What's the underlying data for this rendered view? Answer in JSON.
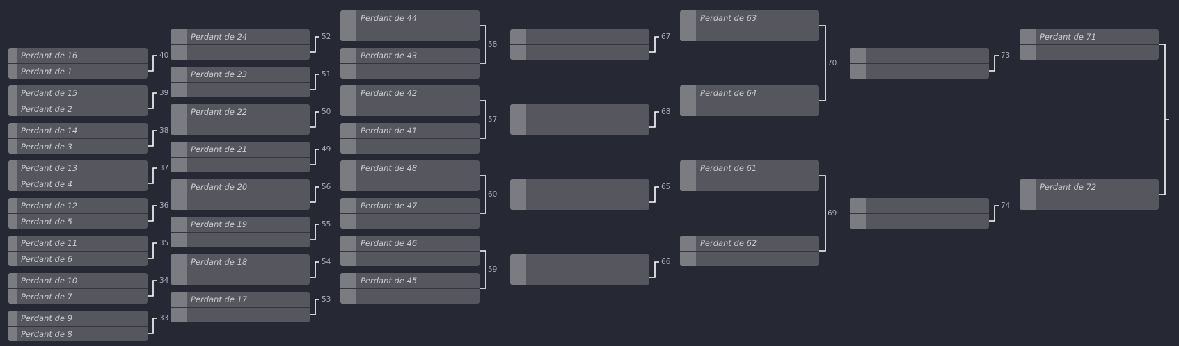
{
  "rounds": [
    {
      "id": "r1",
      "matches": [
        {
          "top": "Perdant de 16",
          "bottom": "Perdant de 1",
          "target": "40"
        },
        {
          "top": "Perdant de 15",
          "bottom": "Perdant de 2",
          "target": "39"
        },
        {
          "top": "Perdant de 14",
          "bottom": "Perdant de 3",
          "target": "38"
        },
        {
          "top": "Perdant de 13",
          "bottom": "Perdant de 4",
          "target": "37"
        },
        {
          "top": "Perdant de 12",
          "bottom": "Perdant de 5",
          "target": "36"
        },
        {
          "top": "Perdant de 11",
          "bottom": "Perdant de 6",
          "target": "35"
        },
        {
          "top": "Perdant de 10",
          "bottom": "Perdant de 7",
          "target": "34"
        },
        {
          "top": "Perdant de 9",
          "bottom": "Perdant de 8",
          "target": "33"
        }
      ]
    },
    {
      "id": "r2",
      "matches": [
        {
          "top": "Perdant de 24",
          "bottom": "",
          "target": "52"
        },
        {
          "top": "Perdant de 23",
          "bottom": "",
          "target": "51"
        },
        {
          "top": "Perdant de 22",
          "bottom": "",
          "target": "50"
        },
        {
          "top": "Perdant de 21",
          "bottom": "",
          "target": "49"
        },
        {
          "top": "Perdant de 20",
          "bottom": "",
          "target": "56"
        },
        {
          "top": "Perdant de 19",
          "bottom": "",
          "target": "55"
        },
        {
          "top": "Perdant de 18",
          "bottom": "",
          "target": "54"
        },
        {
          "top": "Perdant de 17",
          "bottom": "",
          "target": "53"
        }
      ]
    },
    {
      "id": "r3",
      "matches": [
        {
          "top": "Perdant de 44",
          "bottom": ""
        },
        {
          "top": "Perdant de 43",
          "bottom": ""
        },
        {
          "top": "Perdant de 42",
          "bottom": ""
        },
        {
          "top": "Perdant de 41",
          "bottom": ""
        },
        {
          "top": "Perdant de 48",
          "bottom": ""
        },
        {
          "top": "Perdant de 47",
          "bottom": ""
        },
        {
          "top": "Perdant de 46",
          "bottom": ""
        },
        {
          "top": "Perdant de 45",
          "bottom": ""
        }
      ],
      "pair_targets": [
        "58",
        "57",
        "60",
        "59"
      ]
    },
    {
      "id": "r4",
      "matches": [
        {
          "top": "",
          "bottom": "",
          "target": "67"
        },
        {
          "top": "",
          "bottom": "",
          "target": "68"
        },
        {
          "top": "",
          "bottom": "",
          "target": "65"
        },
        {
          "top": "",
          "bottom": "",
          "target": "66"
        }
      ]
    },
    {
      "id": "r5",
      "matches": [
        {
          "top": "Perdant de 63",
          "bottom": ""
        },
        {
          "top": "Perdant de 64",
          "bottom": ""
        },
        {
          "top": "Perdant de 61",
          "bottom": ""
        },
        {
          "top": "Perdant de 62",
          "bottom": ""
        }
      ],
      "pair_targets": [
        "70",
        "69"
      ]
    },
    {
      "id": "r6",
      "matches": [
        {
          "top": "",
          "bottom": "",
          "target": "73"
        },
        {
          "top": "",
          "bottom": "",
          "target": "74"
        }
      ]
    },
    {
      "id": "r7",
      "matches": [
        {
          "top": "Perdant de 71",
          "bottom": ""
        },
        {
          "top": "Perdant de 72",
          "bottom": ""
        }
      ]
    }
  ],
  "colors": {
    "background": "#262833",
    "card": "#56575e",
    "seed": "#7b7c82",
    "line": "#ffffff",
    "text": "#c9cad0",
    "number": "#a9aab2"
  }
}
